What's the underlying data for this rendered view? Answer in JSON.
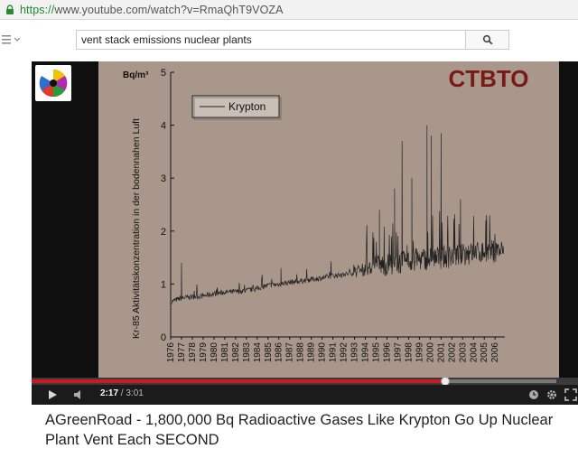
{
  "browser": {
    "url_scheme": "https://",
    "url_rest": "www.youtube.com/watch?v=RmaQhT9VOZA"
  },
  "header": {
    "search_value": "vent stack emissions nuclear plants"
  },
  "player": {
    "time_current": "2:17",
    "time_separator": " / ",
    "time_total": "3:01",
    "progress_fraction": 0.757,
    "buffer_fraction": 0.96
  },
  "slide": {
    "watermark": "CTBTO",
    "y_unit": "Bq/m³"
  },
  "video": {
    "title": "AGreenRoad - 1,800,000 Bq Radioactive Gases Like Krypton Go Up Nuclear Plant Vent Each SECOND"
  },
  "chart_data": {
    "type": "line",
    "title": "",
    "xlabel": "",
    "ylabel": "Kr-85 Aktivitätskonzentration in der bodennahen Luft",
    "ylim": [
      0,
      5
    ],
    "yticks": [
      "0",
      "1",
      "2",
      "3",
      "4",
      "5"
    ],
    "xticks": [
      "1976",
      "1977",
      "1978",
      "1979",
      "1980",
      "1981",
      "1982",
      "1983",
      "1984",
      "1985",
      "1986",
      "1987",
      "1988",
      "1989",
      "1990",
      "1991",
      "1992",
      "1993",
      "1994",
      "1995",
      "1996",
      "1997",
      "1998",
      "1999",
      "2000",
      "2001",
      "2002",
      "2003",
      "2004",
      "2005",
      "2006"
    ],
    "legend": "top-left",
    "grid": false,
    "series": [
      {
        "name": "Krypton",
        "x": [
          1976,
          1977,
          1978,
          1979,
          1980,
          1981,
          1982,
          1983,
          1984,
          1985,
          1986,
          1987,
          1988,
          1989,
          1990,
          1991,
          1992,
          1993,
          1994,
          1995,
          1996,
          1997,
          1998,
          1999,
          2000,
          2001,
          2002,
          2003,
          2004,
          2005,
          2006
        ],
        "values": [
          0.65,
          0.72,
          0.74,
          0.76,
          0.8,
          0.83,
          0.84,
          0.86,
          0.9,
          0.96,
          0.98,
          1.02,
          1.04,
          1.07,
          1.1,
          1.14,
          1.16,
          1.2,
          1.24,
          1.28,
          1.3,
          1.33,
          1.36,
          1.4,
          1.42,
          1.44,
          1.46,
          1.48,
          1.52,
          1.54,
          1.56
        ],
        "peaks": [
          {
            "x": 1977.0,
            "y": 1.4
          },
          {
            "x": 1986.2,
            "y": 1.3
          },
          {
            "x": 1995.3,
            "y": 2.4
          },
          {
            "x": 1996.7,
            "y": 2.8
          },
          {
            "x": 1997.4,
            "y": 3.7
          },
          {
            "x": 1998.3,
            "y": 3.0
          },
          {
            "x": 1999.7,
            "y": 4.0
          },
          {
            "x": 2000.1,
            "y": 3.8
          },
          {
            "x": 2001.0,
            "y": 3.85
          },
          {
            "x": 2002.8,
            "y": 2.6
          },
          {
            "x": 2005.2,
            "y": 2.3
          }
        ]
      }
    ],
    "colors": {
      "line": "#222222",
      "background": "#a8978a",
      "watermark": "#7a1a17"
    }
  }
}
